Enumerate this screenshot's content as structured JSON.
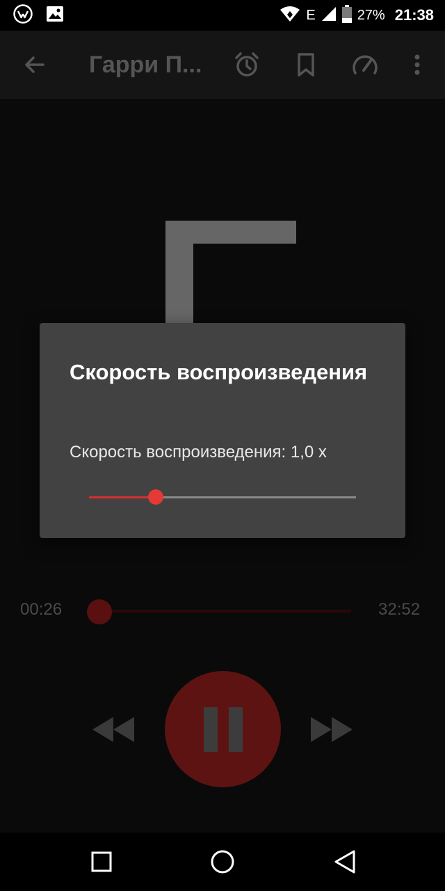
{
  "status_bar": {
    "left_icons": [
      "vk-icon",
      "image-icon"
    ],
    "network_type": "E",
    "battery_level": "27%",
    "time": "21:38"
  },
  "toolbar": {
    "title": "Гарри П...",
    "icons": [
      "back-arrow-icon",
      "alarm-clock-icon",
      "bookmark-icon",
      "speedometer-icon",
      "more-vert-icon"
    ]
  },
  "dialog": {
    "title": "Скорость воспроизведения",
    "speed_label": "Скорость воспроизведения: 1,0 x",
    "speed_fraction": 0.25
  },
  "player": {
    "elapsed": "00:26",
    "duration": "32:52",
    "progress_fraction": 0.013,
    "state": "playing"
  },
  "colors": {
    "accent": "#e53935",
    "dialog_background": "#424242",
    "play_button": "#5e1313"
  },
  "nav_bar": {
    "icons": [
      "recents-square-icon",
      "home-circle-icon",
      "back-triangle-icon"
    ]
  }
}
